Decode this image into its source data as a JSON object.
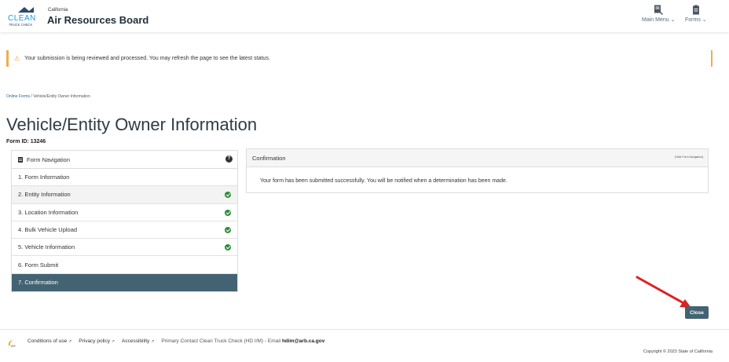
{
  "header": {
    "logo_text": [
      "CLEAN",
      "TRUCK CHECK"
    ],
    "brand_small": "California",
    "brand_big": "Air Resources Board",
    "nav": [
      {
        "label": "Main Menu ⌄",
        "icon": "main-menu-icon"
      },
      {
        "label": "Forms ⌄",
        "icon": "forms-icon"
      }
    ]
  },
  "alert": {
    "icon": "warning-icon",
    "message": "Your submission is being reviewed and processed. You may refresh the page to see the latest status."
  },
  "breadcrumb": {
    "link": "Online Forms",
    "separator": "/",
    "current": "Vehicle/Entity Owner Information"
  },
  "page": {
    "title": "Vehicle/Entity Owner Information",
    "form_id": "Form ID: 13246"
  },
  "sidebar": {
    "title": "Form Navigation",
    "help_icon": "question-circle-icon",
    "items": [
      {
        "label": "1. Form Information",
        "checked": false
      },
      {
        "label": "2. Entity Information",
        "checked": true
      },
      {
        "label": "3. Location Information",
        "checked": true
      },
      {
        "label": "4. Bulk Vehicle Upload",
        "checked": true
      },
      {
        "label": "5. Vehicle Information",
        "checked": true
      },
      {
        "label": "6. Form Submit",
        "checked": false
      },
      {
        "label": "7. Confirmation",
        "checked": false,
        "active": true
      }
    ]
  },
  "panel": {
    "title": "Confirmation",
    "hide_nav": "[Hide Form Navigation]",
    "message": "Your form has been submitted successfully. You will be notified when a determination has been made."
  },
  "close_button": "Close",
  "footer": {
    "links": [
      "Conditions of use",
      "Privacy policy",
      "Accessibility"
    ],
    "contact_prefix": "Primary Contact Clean Truck Check (HD I/M) - Email",
    "contact_email": "hdim@arb.ca.gov",
    "copyright": "Copyright © 2023 State of California"
  },
  "colors": {
    "accent": "#436373",
    "warning": "#f0ad4e",
    "check": "#2f8f3b",
    "arrow": "#e02020"
  }
}
